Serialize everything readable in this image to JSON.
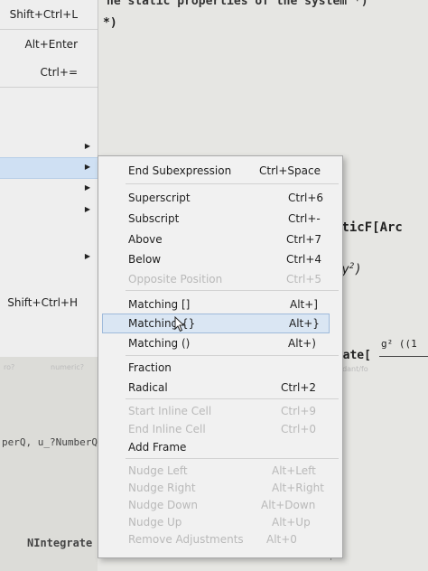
{
  "parent_menu": {
    "items": [
      {
        "shortcut": "Shift+Ctrl+L"
      },
      {
        "shortcut": "Alt+Enter"
      },
      {
        "shortcut": "Ctrl+="
      },
      {
        "shortcut": "Shift+Ctrl+H"
      }
    ]
  },
  "notebook": {
    "comment_top": "he static properties of the system *)",
    "comment_close": "*)",
    "line_elliptic": "pticF[Arc",
    "line_xy": "xy",
    "line_xy_exp": "2",
    "line_grate": "grate[",
    "line_grate_num": "g² ((1",
    "line_perq": "perQ, u_?NumberQ]",
    "line_nintegrate": "NIntegrate",
    "faint_left": "ro?",
    "faint_mid": "numeric?",
    "faint_right": "pendant/fo"
  },
  "submenu": {
    "items": [
      {
        "label": "End Subexpression",
        "shortcut": "Ctrl+Space",
        "enabled": true
      },
      {
        "label": "Superscript",
        "shortcut": "Ctrl+6",
        "enabled": true
      },
      {
        "label": "Subscript",
        "shortcut": "Ctrl+-",
        "enabled": true
      },
      {
        "label": "Above",
        "shortcut": "Ctrl+7",
        "enabled": true
      },
      {
        "label": "Below",
        "shortcut": "Ctrl+4",
        "enabled": true
      },
      {
        "label": "Opposite Position",
        "shortcut": "Ctrl+5",
        "enabled": false
      },
      {
        "label": "Matching []",
        "shortcut": "Alt+]",
        "enabled": true
      },
      {
        "label": "Matching {}",
        "shortcut": "Alt+}",
        "enabled": true,
        "highlighted": true
      },
      {
        "label": "Matching ()",
        "shortcut": "Alt+)",
        "enabled": true
      },
      {
        "label": "Fraction",
        "shortcut": "",
        "enabled": true
      },
      {
        "label": "Radical",
        "shortcut": "Ctrl+2",
        "enabled": true
      },
      {
        "label": "Start Inline Cell",
        "shortcut": "Ctrl+9",
        "enabled": false
      },
      {
        "label": "End Inline Cell",
        "shortcut": "Ctrl+0",
        "enabled": false
      },
      {
        "label": "Add Frame",
        "shortcut": "",
        "enabled": true
      },
      {
        "label": "Nudge Left",
        "shortcut": "Alt+Left",
        "enabled": false
      },
      {
        "label": "Nudge Right",
        "shortcut": "Alt+Right",
        "enabled": false
      },
      {
        "label": "Nudge Down",
        "shortcut": "Alt+Down",
        "enabled": false
      },
      {
        "label": "Nudge Up",
        "shortcut": "Alt+Up",
        "enabled": false
      },
      {
        "label": "Remove Adjustments",
        "shortcut": "Alt+0",
        "enabled": false
      }
    ]
  },
  "colors": {
    "menu_bg": "#f1f1f1",
    "highlight": "#dae6f3",
    "disabled_text": "#b9b9b9"
  }
}
